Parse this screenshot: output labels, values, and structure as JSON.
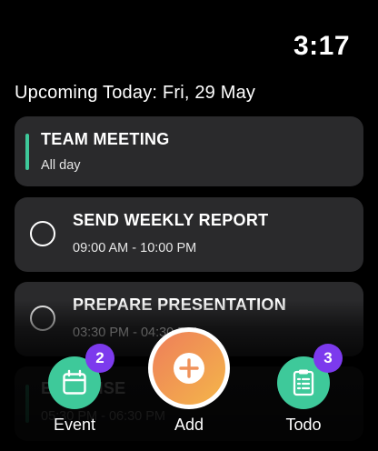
{
  "status": {
    "time": "3:17"
  },
  "heading": "Upcoming Today: Fri, 29 May",
  "colors": {
    "event_bar": "#3ec99a",
    "card_bg": "#2a2a2c",
    "badge": "#7c3aed",
    "event_button": "#3ec99a",
    "todo_button": "#3ec99a",
    "add_gradient_start": "#f0855a",
    "add_gradient_end": "#f4b84a"
  },
  "items": [
    {
      "type": "event",
      "title": "TEAM MEETING",
      "subtitle": "All day"
    },
    {
      "type": "todo",
      "title": "SEND WEEKLY REPORT",
      "subtitle": "09:00 AM - 10:00 PM"
    },
    {
      "type": "todo",
      "title": "PREPARE PRESENTATION",
      "subtitle": "03:30 PM - 04:30 PM"
    },
    {
      "type": "event",
      "title": "EXERCISE",
      "subtitle": "05:30 PM - 06:30 PM"
    }
  ],
  "actions": {
    "event": {
      "label": "Event",
      "badge": "2",
      "icon": "calendar-icon"
    },
    "add": {
      "label": "Add",
      "icon": "plus-icon"
    },
    "todo": {
      "label": "Todo",
      "badge": "3",
      "icon": "clipboard-checklist-icon"
    }
  }
}
